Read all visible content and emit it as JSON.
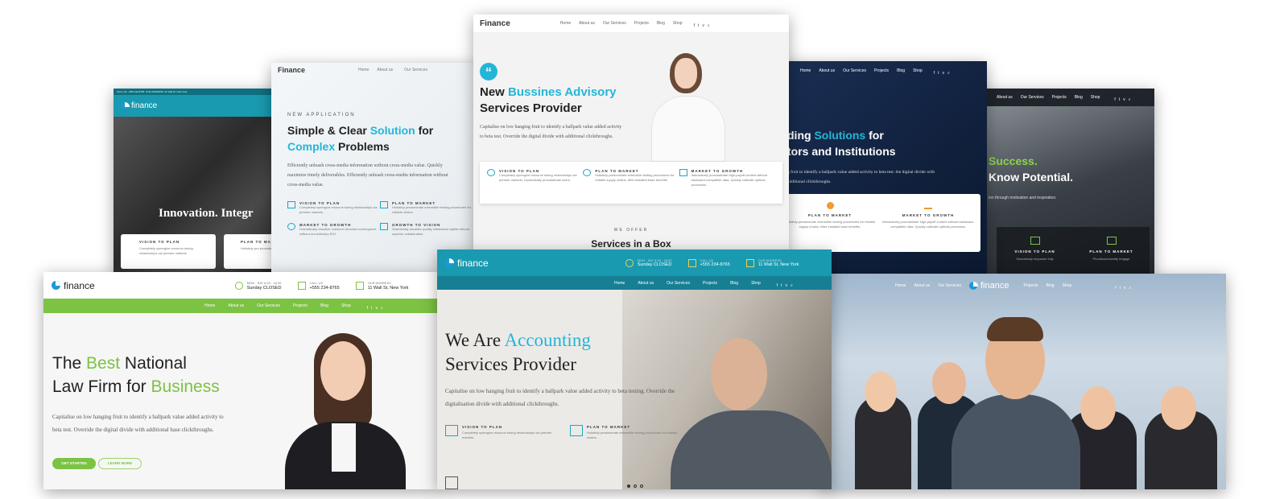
{
  "brand": "Finance",
  "brand_lower": "finance",
  "nav": [
    "Home",
    "About us",
    "Our Services",
    "Projects",
    "Blog",
    "Shop"
  ],
  "c1": {
    "top_left": "CALL US: +555 234-8765",
    "top_addr": "OUR ADDRESS: 11 Wall St, New York",
    "headline": "Innovation. Integr",
    "svc": [
      {
        "t": "VISION TO PLAN",
        "d": "Completely synergize resource taxing relationships via premier markets."
      },
      {
        "t": "PLAN TO MA",
        "d": "Holisticly pro procedures for"
      }
    ]
  },
  "c2": {
    "eyebrow": "NEW APPLICATION",
    "h1": "Simple & Clear ",
    "h1_acc": "Solution",
    "h1_post": " for",
    "h2_acc": "Complex",
    "h2_post": " Problems",
    "body": "Efficiently unleash cross-media information without cross-media value. Quickly maximize timely deliverables. Efficiently unleash cross-media information without cross-media value.",
    "svc": [
      {
        "t": "VISION TO PLAN",
        "d": "Completely synergize resource taxing relationships via premier markets."
      },
      {
        "t": "PLAN TO MARKET",
        "d": "Holisticly predominate extensible testing procedures for reliable chains."
      },
      {
        "t": "MARKET TO GROWTH",
        "d": "Dramatically visualize customer directed convergence without revolutionary ROI."
      },
      {
        "t": "GROWTH TO VISION",
        "d": "Seamlessly visualize quality intellectual capital without superior collaboration."
      }
    ]
  },
  "c3": {
    "h1_pre": "New ",
    "h1_acc": "Bussines Advisory",
    "h2": "Services Provider",
    "body": "Capitalise on low hanging fruit to identify a ballpark value added activity to beta test. Override the digital divide with additional clickthroughs.",
    "svc": [
      {
        "t": "VISION TO PLAN",
        "d": "Completely synergize resource taxing relationships via premier markets. Dynamically procrastinate users."
      },
      {
        "t": "PLAN TO MARKET",
        "d": "Holisticly predominate extensible testing procedures for reliable supply chains. After installed base benefits."
      },
      {
        "t": "MARKET TO GROWTH",
        "d": "Interactively procrastinate high-payoff content without backward-compatible data. Quickly cultivate optimal processes."
      }
    ],
    "we_offer": "WE OFFER",
    "box": "Services in a Box"
  },
  "c4": {
    "h1_pre": "ding ",
    "h1_acc": "Solutions",
    "h1_post": " for",
    "h2": "tors and Institutions",
    "body": "g fruit to identify a ballpark value added activity to beta test. the digital divide with additional clickthroughs.",
    "svc": [
      {
        "t": "PLAN TO MARKET",
        "d": "Holisticly predominate extensible testing procedures for reliable supply chains. After installed base benefits."
      },
      {
        "t": "MARKET TO GROWTH",
        "d": "Interactively procrastinate high-payoff content without backward-compatible data. Quickly cultivate optimal processes."
      }
    ]
  },
  "c5": {
    "h1": "Success.",
    "h2": "Know Potential.",
    "body": "ion through motivation and inspiration.",
    "svc": [
      {
        "t": "VISION TO PLAN",
        "d": "Seamlessly empower fully"
      },
      {
        "t": "PLAN TO MARKET",
        "d": "Phosfluorescently engage"
      }
    ]
  },
  "c6": {
    "info": [
      {
        "l": "MON - SAT 8.00 - 18.00",
        "v": "Sunday CLOSED"
      },
      {
        "l": "CALL US",
        "v": "+555 234-8765"
      },
      {
        "l": "OUR ADDRESS",
        "v": "11 Wall St, New York"
      }
    ],
    "h1_pre": "The ",
    "h1_acc": "Best",
    "h1_post": " National",
    "h2_pre": "Law Firm for ",
    "h2_acc": "Business",
    "body": "Capitalise on low hanging fruit to identify a ballpark value added activity to beta test. Override the digital divide with additional base clickthroughs.",
    "btn1": "GET STARTED",
    "btn2": "LEARN MORE"
  },
  "c7": {
    "info": [
      {
        "l": "MON - SAT 8.00 - 18.00",
        "v": "Sunday CLOSED"
      },
      {
        "l": "CALL US",
        "v": "+555 234-8765"
      },
      {
        "l": "OUR ADDRESS",
        "v": "11 Wall St, New York"
      }
    ],
    "h1_pre": "We Are ",
    "h1_acc": "Accounting",
    "h2": "Services Provider",
    "body": "Capitalise on low hanging fruit to identify a ballpark value added activity to beta testing. Override the digitalisation divide with additional clickthroughs.",
    "svc": [
      {
        "t": "VISION TO PLAN",
        "d": "Completely synergize resource taxing relationships via premier markets."
      },
      {
        "t": "PLAN TO MARKET",
        "d": "Holisticly predominate extensible testing procedures for reliable chains."
      }
    ]
  },
  "c8": {
    "nav": [
      "Home",
      "About us",
      "Our Services",
      "Projects",
      "Blog",
      "Shop"
    ]
  },
  "colors": {
    "teal": "#1a9ab0",
    "green": "#7cc243",
    "navy": "#152a4a",
    "cyan": "#23b6d8"
  }
}
